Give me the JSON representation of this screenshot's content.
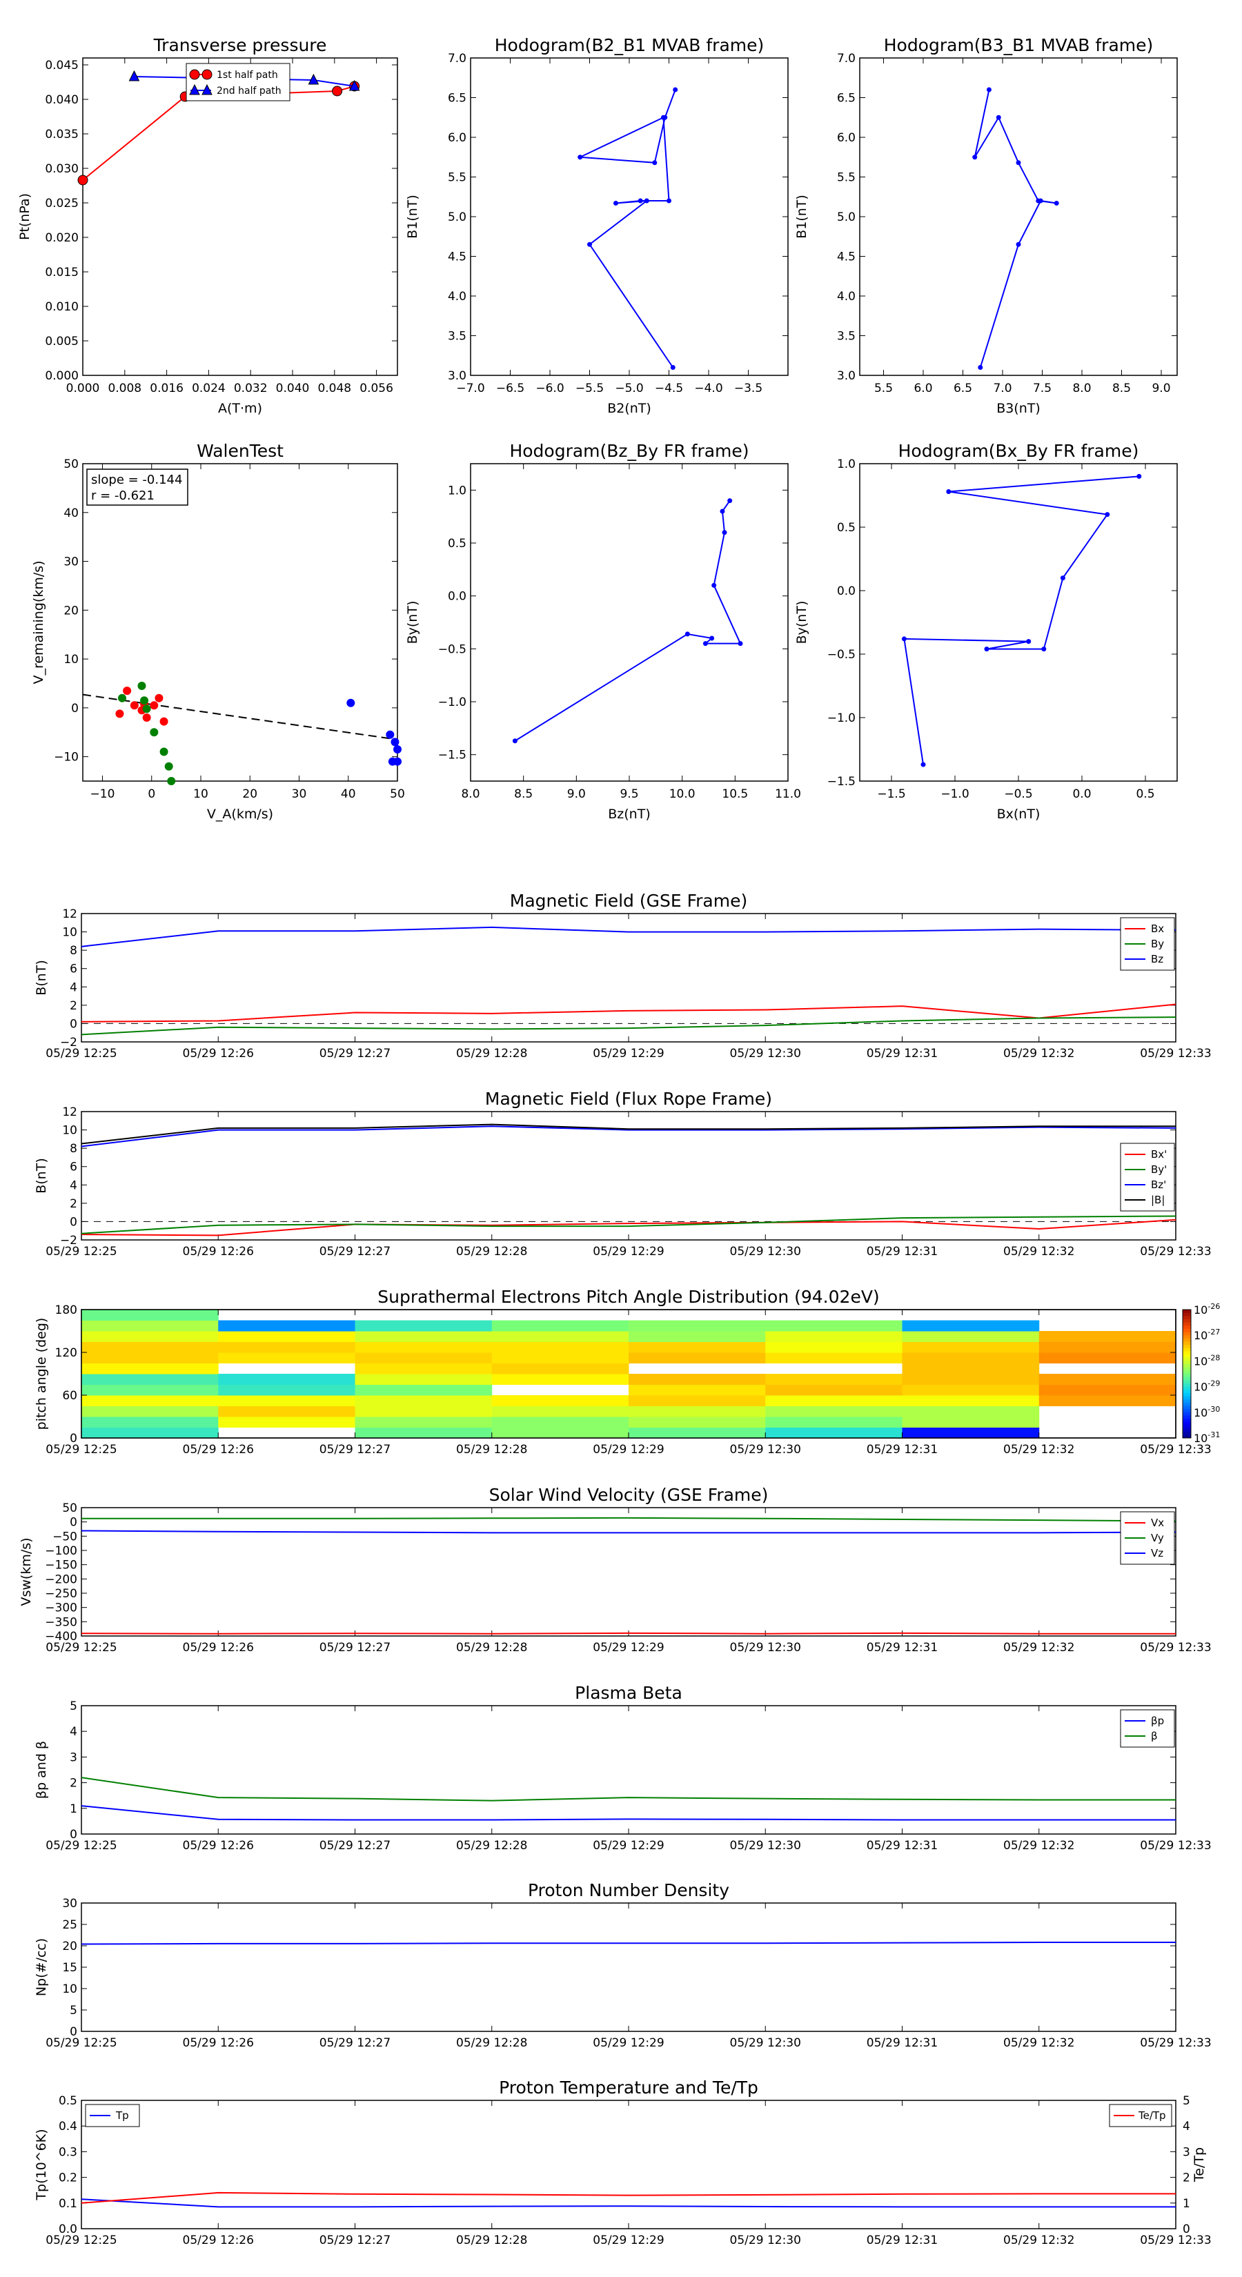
{
  "time_ticks": [
    "05/29 12:25",
    "05/29 12:26",
    "05/29 12:27",
    "05/29 12:28",
    "05/29 12:29",
    "05/29 12:30",
    "05/29 12:31",
    "05/29 12:32",
    "05/29 12:33"
  ],
  "colors": {
    "red": "#ff0000",
    "green": "#008000",
    "blue": "#0000ff",
    "black": "#000000"
  },
  "chart_data": [
    {
      "id": "tp",
      "type": "line",
      "title": "Transverse pressure",
      "xlabel": "A(T·m)",
      "ylabel": "Pt(nPa)",
      "xlim": [
        0,
        0.06
      ],
      "ylim": [
        0,
        0.046
      ],
      "xticks": [
        0,
        0.008,
        0.016,
        0.024,
        0.032,
        0.04,
        0.048,
        0.056
      ],
      "xtick_labels": [
        "0.000",
        "0.008",
        "0.016",
        "0.024",
        "0.032",
        "0.040",
        "0.048",
        "0.056"
      ],
      "yticks": [
        0,
        0.005,
        0.01,
        0.015,
        0.02,
        0.025,
        0.03,
        0.035,
        0.04,
        0.045
      ],
      "ytick_labels": [
        "0.000",
        "0.005",
        "0.010",
        "0.015",
        "0.020",
        "0.025",
        "0.030",
        "0.035",
        "0.040",
        "0.045"
      ],
      "legend": "upper-center",
      "series": [
        {
          "name": "1st half path",
          "color": "#ff0000",
          "marker": "circle",
          "x": [
            0.0,
            0.0195,
            0.0485,
            0.0518
          ],
          "y": [
            0.0283,
            0.0404,
            0.0412,
            0.0419
          ]
        },
        {
          "name": "2nd half path",
          "color": "#0000ff",
          "marker": "triangle",
          "x": [
            0.0098,
            0.044,
            0.0518
          ],
          "y": [
            0.0433,
            0.0428,
            0.0419
          ]
        }
      ]
    },
    {
      "id": "h21",
      "type": "line",
      "title": "Hodogram(B2_B1 MVAB frame)",
      "xlabel": "B2(nT)",
      "ylabel": "B1(nT)",
      "xlim": [
        -7.0,
        -3.0
      ],
      "ylim": [
        3.0,
        7.0
      ],
      "xticks": [
        -7.0,
        -6.5,
        -6.0,
        -5.5,
        -5.0,
        -4.5,
        -4.0,
        -3.5
      ],
      "xtick_labels": [
        "−7.0",
        "−6.5",
        "−6.0",
        "−5.5",
        "−5.0",
        "−4.5",
        "−4.0",
        "−3.5"
      ],
      "yticks": [
        3.0,
        3.5,
        4.0,
        4.5,
        5.0,
        5.5,
        6.0,
        6.5,
        7.0
      ],
      "ytick_labels": [
        "3.0",
        "3.5",
        "4.0",
        "4.5",
        "5.0",
        "5.5",
        "6.0",
        "6.5",
        "7.0"
      ],
      "series": [
        {
          "color": "#0000ff",
          "marker": "dot",
          "x": [
            -4.42,
            -4.55,
            -4.68,
            -5.62,
            -4.57,
            -4.5,
            -4.86,
            -5.17,
            -4.78,
            -5.5,
            -4.45
          ],
          "y": [
            6.6,
            6.25,
            5.68,
            5.75,
            6.25,
            5.2,
            5.2,
            5.17,
            5.2,
            4.65,
            3.1
          ]
        }
      ]
    },
    {
      "id": "h31",
      "type": "line",
      "title": "Hodogram(B3_B1 MVAB frame)",
      "xlabel": "B3(nT)",
      "ylabel": "B1(nT)",
      "xlim": [
        5.2,
        9.2
      ],
      "ylim": [
        3.0,
        7.0
      ],
      "xticks": [
        5.5,
        6.0,
        6.5,
        7.0,
        7.5,
        8.0,
        8.5,
        9.0
      ],
      "xtick_labels": [
        "5.5",
        "6.0",
        "6.5",
        "7.0",
        "7.5",
        "8.0",
        "8.5",
        "9.0"
      ],
      "yticks": [
        3.0,
        3.5,
        4.0,
        4.5,
        5.0,
        5.5,
        6.0,
        6.5,
        7.0
      ],
      "ytick_labels": [
        "3.0",
        "3.5",
        "4.0",
        "4.5",
        "5.0",
        "5.5",
        "6.0",
        "6.5",
        "7.0"
      ],
      "series": [
        {
          "color": "#0000ff",
          "marker": "dot",
          "x": [
            6.83,
            6.65,
            6.95,
            7.2,
            7.45,
            7.68,
            7.48,
            7.2,
            6.72
          ],
          "y": [
            6.6,
            5.75,
            6.25,
            5.68,
            5.2,
            5.17,
            5.2,
            4.65,
            3.1
          ]
        }
      ]
    },
    {
      "id": "walen",
      "type": "scatter",
      "title": "WalenTest",
      "xlabel": "V_A(km/s)",
      "ylabel": "V_remaining(km/s)",
      "xlim": [
        -14,
        50
      ],
      "ylim": [
        -15,
        50
      ],
      "xticks": [
        -10,
        0,
        10,
        20,
        30,
        40,
        50
      ],
      "xtick_labels": [
        "−10",
        "0",
        "10",
        "20",
        "30",
        "40",
        "50"
      ],
      "yticks": [
        -10,
        0,
        10,
        20,
        30,
        40,
        50
      ],
      "ytick_labels": [
        "−10",
        "0",
        "10",
        "20",
        "30",
        "40",
        "50"
      ],
      "annotation": [
        "slope = -0.144",
        "r = -0.621"
      ],
      "fit": {
        "slope": -0.144,
        "intercept": 0.7
      },
      "series": [
        {
          "color": "#ff0000",
          "x": [
            -6.5,
            -5.0,
            -3.5,
            -2.0,
            -1.0,
            0.5,
            1.5,
            2.5,
            -1.5
          ],
          "y": [
            -1.2,
            3.5,
            0.5,
            -0.5,
            -2.0,
            0.5,
            2.0,
            -2.8,
            0.8
          ]
        },
        {
          "color": "#008000",
          "x": [
            -6.0,
            -2.0,
            -1.5,
            0.5,
            2.5,
            3.5,
            4.0,
            -1.0
          ],
          "y": [
            2.0,
            4.5,
            1.5,
            -5.0,
            -9.0,
            -12.0,
            -15.0,
            -0.2
          ]
        },
        {
          "color": "#0000ff",
          "x": [
            40.5,
            48.5,
            49.5,
            50.0,
            49.0,
            50.0
          ],
          "y": [
            1.0,
            -5.5,
            -7.0,
            -8.5,
            -11.0,
            -11.0
          ]
        }
      ]
    },
    {
      "id": "hzy",
      "type": "line",
      "title": "Hodogram(Bz_By FR frame)",
      "xlabel": "Bz(nT)",
      "ylabel": "By(nT)",
      "xlim": [
        8.0,
        11.0
      ],
      "ylim": [
        -1.75,
        1.25
      ],
      "xticks": [
        8.0,
        8.5,
        9.0,
        9.5,
        10.0,
        10.5,
        11.0
      ],
      "xtick_labels": [
        "8.0",
        "8.5",
        "9.0",
        "9.5",
        "10.0",
        "10.5",
        "11.0"
      ],
      "yticks": [
        -1.5,
        -1.0,
        -0.5,
        0.0,
        0.5,
        1.0
      ],
      "ytick_labels": [
        "−1.5",
        "−1.0",
        "−0.5",
        "0.0",
        "0.5",
        "1.0"
      ],
      "series": [
        {
          "color": "#0000ff",
          "marker": "dot",
          "x": [
            10.45,
            10.38,
            10.4,
            10.3,
            10.55,
            10.22,
            10.28,
            10.05,
            8.42
          ],
          "y": [
            0.9,
            0.8,
            0.6,
            0.1,
            -0.45,
            -0.45,
            -0.4,
            -0.36,
            -1.37
          ]
        }
      ]
    },
    {
      "id": "hxy",
      "type": "line",
      "title": "Hodogram(Bx_By FR frame)",
      "xlabel": "Bx(nT)",
      "ylabel": "By(nT)",
      "xlim": [
        -1.75,
        0.75
      ],
      "ylim": [
        -1.5,
        1.0
      ],
      "xticks": [
        -1.5,
        -1.0,
        -0.5,
        0.0,
        0.5
      ],
      "xtick_labels": [
        "−1.5",
        "−1.0",
        "−0.5",
        "0.0",
        "0.5"
      ],
      "yticks": [
        -1.5,
        -1.0,
        -0.5,
        0.0,
        0.5,
        1.0
      ],
      "ytick_labels": [
        "−1.5",
        "−1.0",
        "−0.5",
        "0.0",
        "0.5",
        "1.0"
      ],
      "series": [
        {
          "color": "#0000ff",
          "marker": "dot",
          "x": [
            0.45,
            -1.05,
            0.2,
            -0.15,
            -0.3,
            -0.75,
            -0.42,
            -1.4,
            -1.25
          ],
          "y": [
            0.9,
            0.78,
            0.6,
            0.1,
            -0.46,
            -0.46,
            -0.4,
            -0.38,
            -1.37
          ]
        }
      ]
    },
    {
      "id": "mag_gse",
      "type": "line",
      "title": "Magnetic Field (GSE Frame)",
      "ylabel": "B(nT)",
      "ylim": [
        -2,
        12
      ],
      "yticks": [
        -2,
        0,
        2,
        4,
        6,
        8,
        10,
        12
      ],
      "ytick_labels": [
        "−2",
        "0",
        "2",
        "4",
        "6",
        "8",
        "10",
        "12"
      ],
      "zero_line": true,
      "legend": "upper-right",
      "series": [
        {
          "name": "Bx",
          "color": "#ff0000",
          "values": [
            0.2,
            0.3,
            1.2,
            1.1,
            1.4,
            1.5,
            1.9,
            0.6,
            2.1
          ]
        },
        {
          "name": "By",
          "color": "#008000",
          "values": [
            -1.2,
            -0.4,
            -0.5,
            -0.6,
            -0.5,
            -0.2,
            0.3,
            0.6,
            0.7
          ]
        },
        {
          "name": "Bz",
          "color": "#0000ff",
          "values": [
            8.4,
            10.1,
            10.1,
            10.5,
            10.0,
            10.0,
            10.1,
            10.3,
            10.2
          ]
        }
      ]
    },
    {
      "id": "mag_fr",
      "type": "line",
      "title": "Magnetic Field (Flux Rope Frame)",
      "ylabel": "B(nT)",
      "ylim": [
        -2,
        12
      ],
      "yticks": [
        -2,
        0,
        2,
        4,
        6,
        8,
        10,
        12
      ],
      "ytick_labels": [
        "−2",
        "0",
        "2",
        "4",
        "6",
        "8",
        "10",
        "12"
      ],
      "zero_line": true,
      "legend": "center-right",
      "series": [
        {
          "name": "Bx'",
          "color": "#ff0000",
          "values": [
            -1.4,
            -1.5,
            -0.3,
            -0.4,
            -0.2,
            -0.1,
            0.0,
            -0.8,
            0.2
          ]
        },
        {
          "name": "By'",
          "color": "#008000",
          "values": [
            -1.3,
            -0.4,
            -0.3,
            -0.5,
            -0.5,
            -0.1,
            0.4,
            0.5,
            0.6
          ]
        },
        {
          "name": "Bz'",
          "color": "#0000ff",
          "values": [
            8.2,
            10.0,
            10.0,
            10.4,
            10.0,
            10.0,
            10.1,
            10.3,
            10.2
          ]
        },
        {
          "name": "|B|",
          "color": "#000000",
          "values": [
            8.5,
            10.2,
            10.2,
            10.6,
            10.1,
            10.1,
            10.2,
            10.4,
            10.4
          ]
        }
      ]
    },
    {
      "id": "pad",
      "type": "heatmap",
      "title": "Suprathermal Electrons Pitch Angle Distribution (94.02eV)",
      "ylabel": "pitch angle (deg)",
      "ylim": [
        0,
        180
      ],
      "yticks": [
        0,
        60,
        120,
        180
      ],
      "ytick_labels": [
        "0",
        "60",
        "120",
        "180"
      ],
      "colorbar": {
        "min_exp": -31,
        "max_exp": -26,
        "ticks": [
          "10^-26",
          "10^-27",
          "10^-28",
          "10^-29",
          "10^-30",
          "10^-31"
        ]
      },
      "bins": [
        0,
        15,
        30,
        45,
        60,
        75,
        90,
        105,
        120,
        135,
        150,
        165,
        180
      ],
      "columns": [
        [
          -28.9,
          -28.7,
          -28.2,
          -27.8,
          -28.6,
          -28.8,
          -27.7,
          -27.5,
          -27.5,
          -27.9,
          -28.2,
          -28.6
        ],
        [
          null,
          -27.8,
          -27.5,
          -27.8,
          -28.9,
          -29.0,
          null,
          -27.6,
          -27.5,
          -27.7,
          -29.6,
          null
        ],
        [
          -28.6,
          -28.3,
          -27.9,
          -27.9,
          -28.5,
          -27.9,
          -27.6,
          -27.5,
          -27.6,
          -28.0,
          -28.9,
          null
        ],
        [
          -28.4,
          -28.4,
          -28.0,
          -27.7,
          null,
          -27.7,
          -27.5,
          -27.6,
          -27.6,
          -28.0,
          -28.5,
          null
        ],
        [
          -28.6,
          -28.2,
          -28.0,
          -27.5,
          -27.6,
          -27.4,
          null,
          -27.4,
          -27.5,
          -28.3,
          -28.4,
          null
        ],
        [
          -29.0,
          -28.5,
          -28.2,
          -27.8,
          -27.4,
          -27.5,
          null,
          -27.6,
          -27.8,
          -27.9,
          -28.4,
          null
        ],
        [
          -30.3,
          -28.2,
          -28.2,
          -27.8,
          -27.5,
          -27.4,
          -27.4,
          -27.4,
          -27.5,
          -28.1,
          -29.5,
          null
        ],
        [
          null,
          null,
          null,
          -27.2,
          -27.1,
          -27.2,
          null,
          -27.1,
          -27.2,
          -27.3,
          null,
          null
        ]
      ]
    },
    {
      "id": "vsw",
      "type": "line",
      "title": "Solar Wind Velocity (GSE Frame)",
      "ylabel": "Vsw(km/s)",
      "ylim": [
        -400,
        50
      ],
      "yticks": [
        -400,
        -350,
        -300,
        -250,
        -200,
        -150,
        -100,
        -50,
        0,
        50
      ],
      "ytick_labels": [
        "−400",
        "−350",
        "−300",
        "−250",
        "−200",
        "−150",
        "−100",
        "−50",
        "0",
        "50"
      ],
      "legend": "upper-right",
      "series": [
        {
          "name": "Vx",
          "color": "#ff0000",
          "values": [
            -391,
            -392,
            -391,
            -392,
            -390,
            -392,
            -390,
            -392,
            -392
          ]
        },
        {
          "name": "Vy",
          "color": "#008000",
          "values": [
            12,
            12,
            12,
            13,
            14,
            12,
            9,
            6,
            3
          ]
        },
        {
          "name": "Vz",
          "color": "#0000ff",
          "values": [
            -31,
            -34,
            -36,
            -38,
            -38,
            -38,
            -38,
            -38,
            -36
          ]
        }
      ]
    },
    {
      "id": "beta",
      "type": "line",
      "title": "Plasma Beta",
      "ylabel": "βp and β",
      "ylim": [
        0,
        5
      ],
      "yticks": [
        0,
        1,
        2,
        3,
        4,
        5
      ],
      "ytick_labels": [
        "0",
        "1",
        "2",
        "3",
        "4",
        "5"
      ],
      "legend": "upper-right",
      "series": [
        {
          "name": "βp",
          "color": "#0000ff",
          "values": [
            1.1,
            0.57,
            0.55,
            0.55,
            0.58,
            0.57,
            0.55,
            0.55,
            0.55
          ]
        },
        {
          "name": "β",
          "color": "#008000",
          "values": [
            2.2,
            1.42,
            1.38,
            1.3,
            1.42,
            1.38,
            1.35,
            1.33,
            1.33
          ]
        }
      ]
    },
    {
      "id": "np",
      "type": "line",
      "title": "Proton Number Density",
      "ylabel": "Np(#/cc)",
      "ylim": [
        0,
        30
      ],
      "yticks": [
        0,
        5,
        10,
        15,
        20,
        25,
        30
      ],
      "ytick_labels": [
        "0",
        "5",
        "10",
        "15",
        "20",
        "25",
        "30"
      ],
      "series": [
        {
          "color": "#0000ff",
          "values": [
            20.4,
            20.5,
            20.5,
            20.6,
            20.6,
            20.6,
            20.7,
            20.8,
            20.8
          ]
        }
      ]
    },
    {
      "id": "tp_temp",
      "type": "line",
      "title": "Proton Temperature and Te/Tp",
      "ylabel": "Tp(10^6K)",
      "ylabel_right": "Te/Tp",
      "ylim": [
        0,
        0.5
      ],
      "yticks": [
        0,
        0.1,
        0.2,
        0.3,
        0.4,
        0.5
      ],
      "ytick_labels": [
        "0.0",
        "0.1",
        "0.2",
        "0.3",
        "0.4",
        "0.5"
      ],
      "ylim_right": [
        0,
        5
      ],
      "yticks_right": [
        0,
        1,
        2,
        3,
        4,
        5
      ],
      "ytick_labels_right": [
        "0",
        "1",
        "2",
        "3",
        "4",
        "5"
      ],
      "series": [
        {
          "name": "Tp",
          "color": "#0000ff",
          "axis": "left",
          "values": [
            0.115,
            0.085,
            0.085,
            0.087,
            0.088,
            0.086,
            0.085,
            0.085,
            0.085
          ]
        },
        {
          "name": "Te/Tp",
          "color": "#ff0000",
          "axis": "right",
          "values": [
            1.0,
            1.4,
            1.35,
            1.33,
            1.3,
            1.32,
            1.35,
            1.36,
            1.36
          ]
        }
      ]
    }
  ]
}
